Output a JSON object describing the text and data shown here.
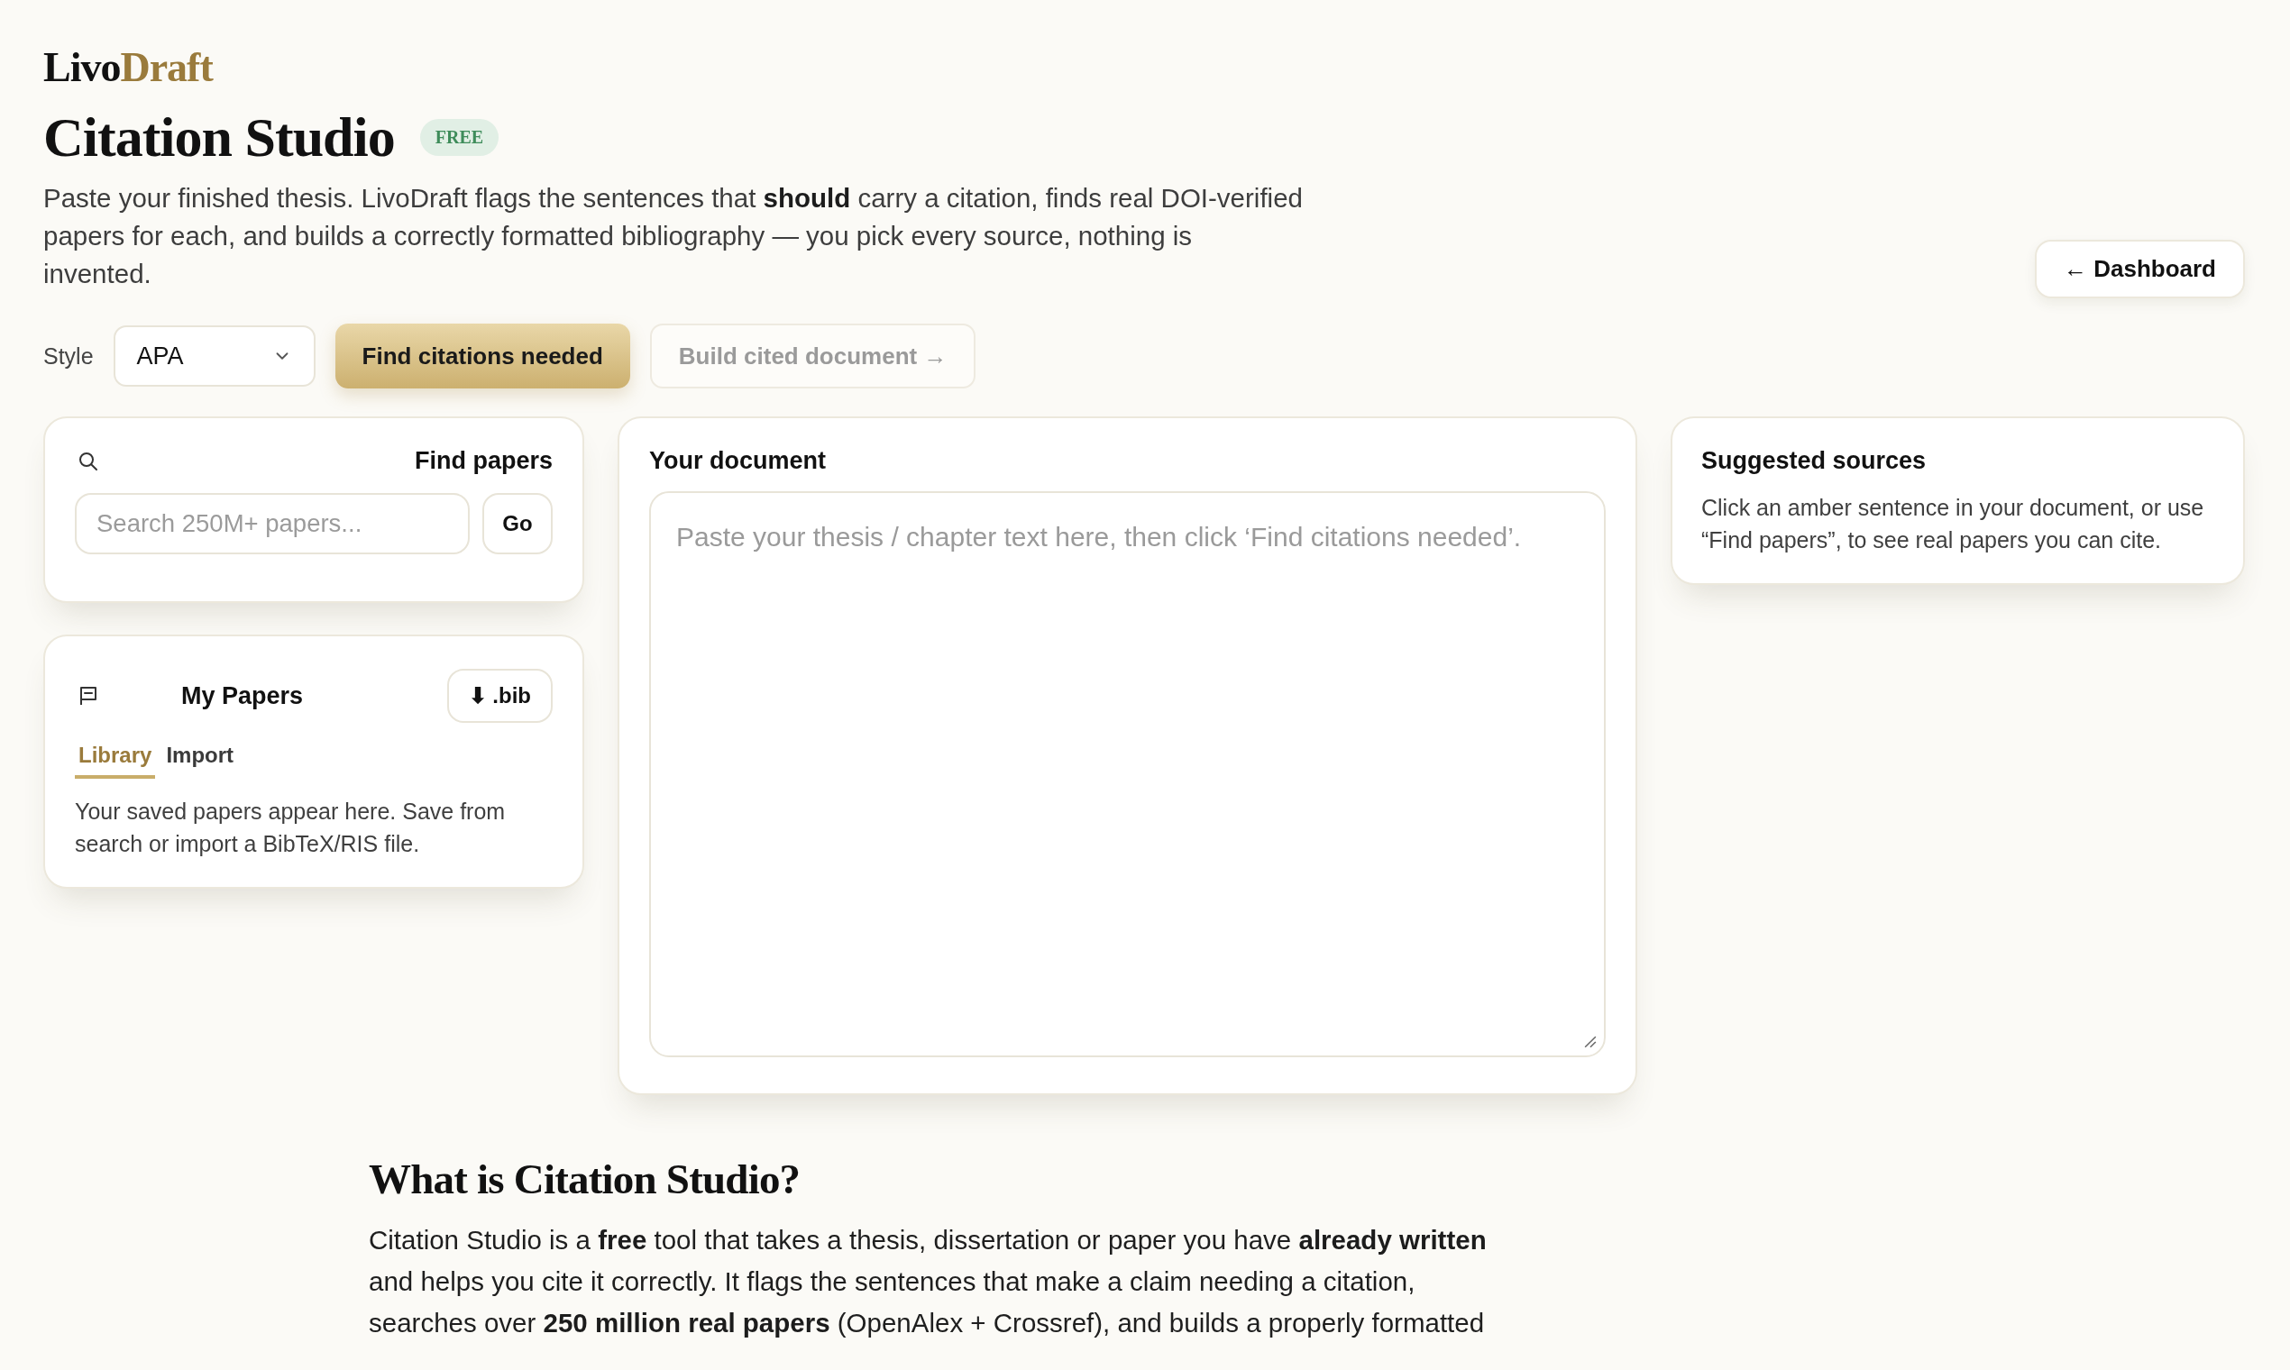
{
  "logo": {
    "text": "Livo",
    "accent": "Draft"
  },
  "page": {
    "title": "Citation Studio",
    "badge": "FREE",
    "description": "Paste your finished thesis. LivoDraft flags the sentences that **should** carry a citation, finds real DOI-verified papers for each, and builds a correctly formatted bibliography — you pick every source, nothing is invented."
  },
  "nav_button": {
    "label": "← Dashboard"
  },
  "toolbar": {
    "style_label": "Style",
    "style_select": {
      "value": "APA"
    },
    "buttons": [
      {
        "label": "Find citations needed",
        "kind": "primary",
        "disabled": false
      },
      {
        "label": "Build cited document →",
        "kind": "secondary",
        "disabled": true
      }
    ]
  },
  "find_papers": {
    "title": "Find papers",
    "search": {
      "placeholder": "Search 250M+ papers..."
    },
    "go_button": "Go"
  },
  "my_papers": {
    "title": "My Papers",
    "export_button": "⬇ .bib",
    "tabs": [
      {
        "label": "Library",
        "selected": true
      },
      {
        "label": "Import",
        "selected": false
      }
    ],
    "empty_text": "Your saved papers appear here. Save from search or import a BibTeX/RIS file."
  },
  "document": {
    "title": "Your document",
    "editor": {
      "placeholder": "Paste your thesis / chapter text here, then click ‘Find citations needed’."
    }
  },
  "suggested_sources": {
    "title": "Suggested sources",
    "empty_text": "Click an amber sentence in your document, or use “Find papers”, to see real papers you can cite."
  },
  "about": {
    "heading": "What is Citation Studio?",
    "paragraph": "Citation Studio is a **free** tool that takes a thesis, dissertation or paper you have **already written** and helps you cite it correctly. It flags the sentences that make a claim needing a citation, searches over **250 million real papers** (OpenAlex + Crossref), and builds a properly formatted"
  }
}
